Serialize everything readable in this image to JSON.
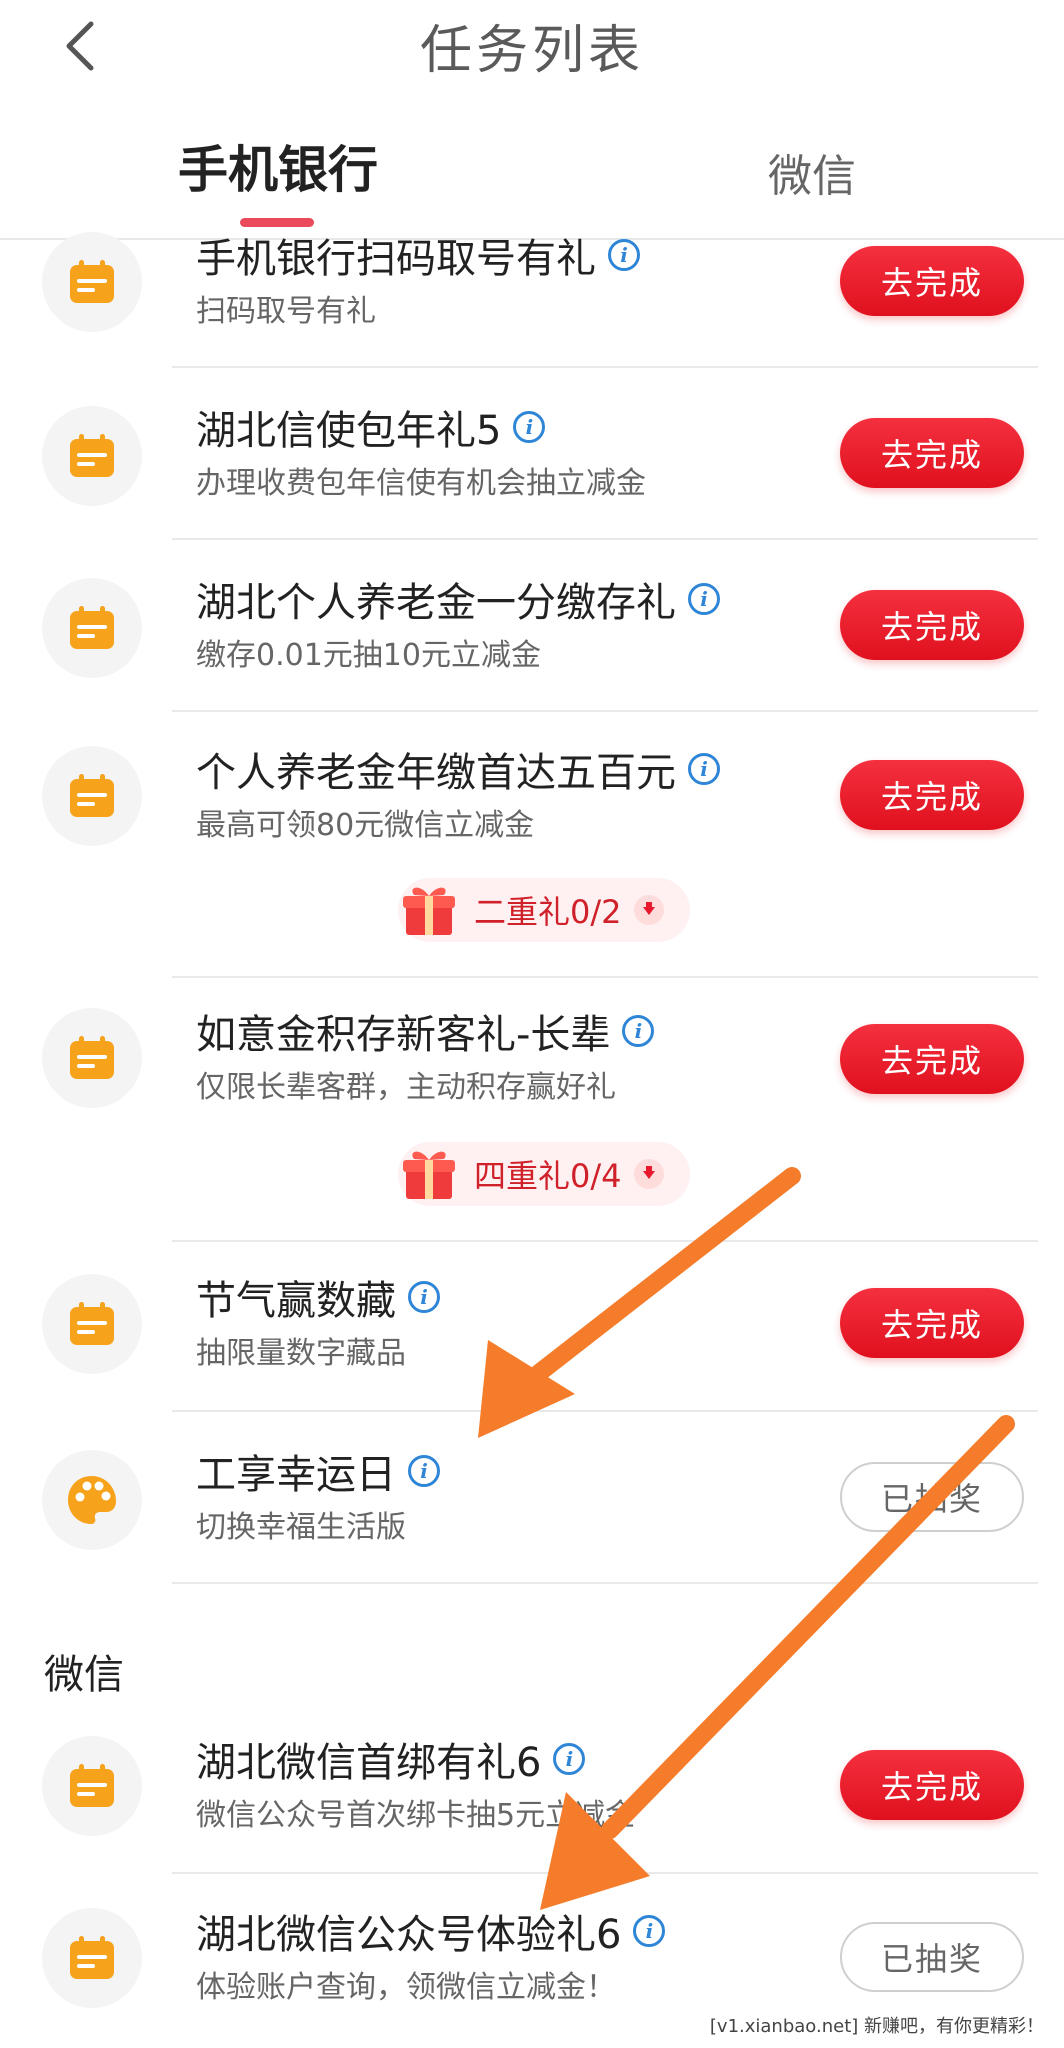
{
  "header": {
    "title": "任务列表",
    "back_icon": "chevron-left-icon"
  },
  "tabs": [
    {
      "label": "手机银行",
      "active": true
    },
    {
      "label": "微信",
      "active": false
    }
  ],
  "bank_tasks": [
    {
      "title": "手机银行扫码取号有礼",
      "subtitle": "扫码取号有礼",
      "button": "去完成",
      "icon": "calendar-icon"
    },
    {
      "title": "湖北信使包年礼5",
      "subtitle": "办理收费包年信使有机会抽立减金",
      "button": "去完成",
      "icon": "calendar-icon"
    },
    {
      "title": "湖北个人养老金一分缴存礼",
      "subtitle": "缴存0.01元抽10元立减金",
      "button": "去完成",
      "icon": "calendar-icon"
    },
    {
      "title": "个人养老金年缴首达五百元",
      "subtitle": "最高可领80元微信立减金",
      "button": "去完成",
      "icon": "calendar-icon",
      "gift": "二重礼0/2"
    },
    {
      "title": "如意金积存新客礼-长辈",
      "subtitle": "仅限长辈客群，主动积存赢好礼",
      "button": "去完成",
      "icon": "calendar-icon",
      "gift": "四重礼0/4"
    },
    {
      "title": "节气赢数藏",
      "subtitle": "抽限量数字藏品",
      "button": "去完成",
      "icon": "calendar-icon"
    },
    {
      "title": "工享幸运日",
      "subtitle": "切换幸福生活版",
      "button": "已抽奖",
      "icon": "palette-icon"
    }
  ],
  "wechat_section": {
    "title": "微信",
    "tasks": [
      {
        "title": "湖北微信首绑有礼6",
        "subtitle": "微信公众号首次绑卡抽5元立减金",
        "button": "去完成",
        "icon": "calendar-icon"
      },
      {
        "title": "湖北微信公众号体验礼6",
        "subtitle": "体验账户查询，领微信立减金！",
        "button": "已抽奖",
        "icon": "calendar-icon"
      }
    ]
  },
  "watermark": "[v1.xianbao.net] 新赚吧，有你更精彩！",
  "colors": {
    "primary_red": "#e8192c",
    "accent_orange": "#f7a21b",
    "info_blue": "#2f86d6",
    "annotation_arrow": "#f57c2a"
  }
}
